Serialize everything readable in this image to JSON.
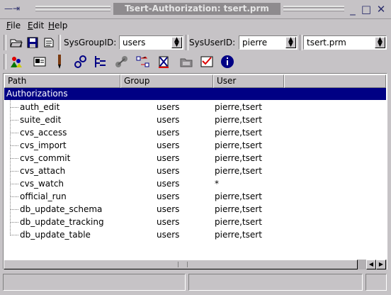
{
  "window": {
    "title": "Tsert-Authorization: tsert.prm",
    "minimize_glyph": "_",
    "maximize_glyph": "□",
    "close_glyph": "✕",
    "menu_glyph": "—⇥"
  },
  "menu": {
    "items": [
      {
        "label": "File",
        "mnemonic": "F",
        "rest": "ile"
      },
      {
        "label": "Edit",
        "mnemonic": "E",
        "rest": "dit"
      },
      {
        "label": "Help",
        "mnemonic": "H",
        "rest": "elp"
      }
    ]
  },
  "toolbar1": {
    "sysgroup_label": "SysGroupID:",
    "sysgroup_value": "users",
    "sysuser_label": "SysUserID:",
    "sysuser_value": "pierre",
    "file_value": "tsert.prm",
    "icons": [
      "open-folder-icon",
      "save-disk-icon",
      "print-icon"
    ]
  },
  "toolbar2": {
    "icons": [
      "users-icon",
      "card-icon",
      "pen-icon",
      "gears-icon",
      "tree-icon",
      "network-icon",
      "transfer-icon",
      "delete-icon",
      "folder-icon",
      "checklist-icon",
      "info-icon"
    ]
  },
  "tree": {
    "columns": [
      "Path",
      "Group",
      "User"
    ],
    "root": "Authorizations",
    "rows": [
      {
        "path": "auth_edit",
        "group": "users",
        "user": "pierre,tsert"
      },
      {
        "path": "suite_edit",
        "group": "users",
        "user": "pierre,tsert"
      },
      {
        "path": "cvs_access",
        "group": "users",
        "user": "pierre,tsert"
      },
      {
        "path": "cvs_import",
        "group": "users",
        "user": "pierre,tsert"
      },
      {
        "path": "cvs_commit",
        "group": "users",
        "user": "pierre,tsert"
      },
      {
        "path": "cvs_attach",
        "group": "users",
        "user": "pierre,tsert"
      },
      {
        "path": "cvs_watch",
        "group": "users",
        "user": "*"
      },
      {
        "path": "official_run",
        "group": "users",
        "user": "pierre,tsert"
      },
      {
        "path": "db_update_schema",
        "group": "users",
        "user": "pierre,tsert"
      },
      {
        "path": "db_update_tracking",
        "group": "users",
        "user": "pierre,tsert"
      },
      {
        "path": "db_update_table",
        "group": "users",
        "user": "pierre,tsert"
      }
    ]
  },
  "colors": {
    "selection": "#000084",
    "chrome": "#c6c3c6"
  }
}
